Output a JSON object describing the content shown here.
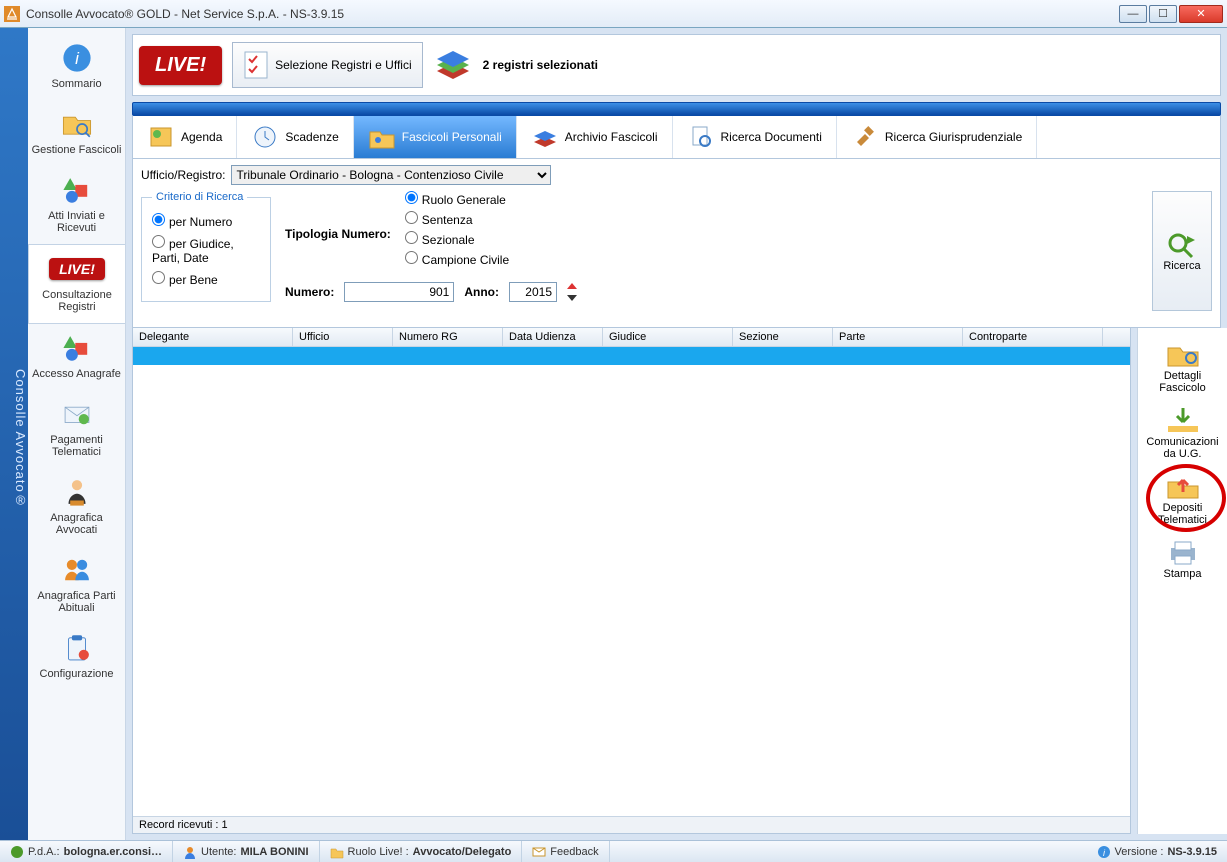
{
  "window": {
    "title": "Consolle Avvocato® GOLD - Net Service S.p.A. - NS-3.9.15"
  },
  "brand": "Consolle Avvocato®",
  "sidebar": {
    "items": [
      {
        "label": "Sommario"
      },
      {
        "label": "Gestione Fascicoli"
      },
      {
        "label": "Atti Inviati e Ricevuti"
      },
      {
        "label": "Consultazione Registri"
      },
      {
        "label": "Accesso Anagrafe"
      },
      {
        "label": "Pagamenti Telematici"
      },
      {
        "label": "Anagrafica Avvocati"
      },
      {
        "label": "Anagrafica Parti Abituali"
      },
      {
        "label": "Configurazione"
      }
    ]
  },
  "ribbon": {
    "live": "LIVE!",
    "select_button": "Selezione Registri e Uffici",
    "reg_count": "2 registri selezionati"
  },
  "tabs": [
    {
      "label": "Agenda"
    },
    {
      "label": "Scadenze"
    },
    {
      "label": "Fascicoli Personali"
    },
    {
      "label": "Archivio Fascicoli"
    },
    {
      "label": "Ricerca Documenti"
    },
    {
      "label": "Ricerca Giurisprudenziale"
    }
  ],
  "filters": {
    "ufficio_label": "Ufficio/Registro:",
    "ufficio_value": "Tribunale Ordinario - Bologna - Contenzioso Civile",
    "criterio_legend": "Criterio di Ricerca",
    "crit_opts": [
      "per Numero",
      "per Giudice, Parti, Date",
      "per Bene"
    ],
    "tipologia_label": "Tipologia Numero:",
    "tipo_opts": [
      "Ruolo Generale",
      "Sentenza",
      "Sezionale",
      "Campione Civile"
    ],
    "numero_label": "Numero:",
    "numero_value": "901",
    "anno_label": "Anno:",
    "anno_value": "2015",
    "search_btn": "Ricerca"
  },
  "table": {
    "columns": [
      "Delegante",
      "Ufficio",
      "Numero RG",
      "Data Udienza",
      "Giudice",
      "Sezione",
      "Parte",
      "Controparte"
    ],
    "widths": [
      160,
      100,
      110,
      100,
      130,
      100,
      130,
      140
    ],
    "footer": "Record ricevuti : 1"
  },
  "actions": [
    {
      "label": "Dettagli Fascicolo"
    },
    {
      "label": "Comunicazioni da U.G."
    },
    {
      "label": "Depositi Telematici"
    },
    {
      "label": "Stampa"
    }
  ],
  "status": {
    "pda_label": "P.d.A.:",
    "pda_value": "bologna.er.consi…",
    "utente_label": "Utente:",
    "utente_value": "MILA BONINI",
    "ruolo_label": "Ruolo Live! :",
    "ruolo_value": "Avvocato/Delegato",
    "feedback": "Feedback",
    "versione_label": "Versione :",
    "versione_value": "NS-3.9.15"
  }
}
